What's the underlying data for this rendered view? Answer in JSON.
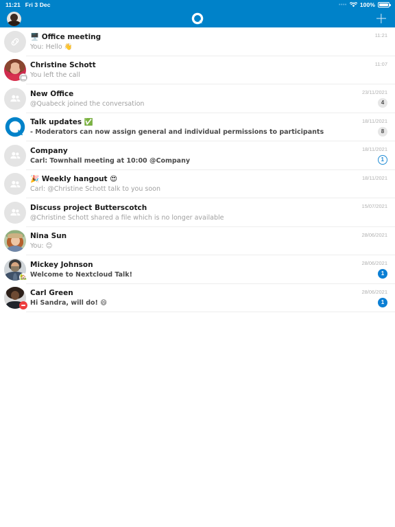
{
  "status_bar": {
    "time": "11:21",
    "date": "Fri 3 Dec",
    "signal_icon": "signal-dots-icon",
    "wifi_icon": "wifi-icon",
    "battery_percent": "100%",
    "battery_icon": "battery-full-icon"
  },
  "nav_bar": {
    "avatar_name": "user-avatar",
    "logo_icon": "nextcloud-talk-logo",
    "add_label": "+",
    "add_name": "new-conversation-button"
  },
  "colors": {
    "brand_blue": "#0082c9",
    "badge_blue": "#0b7fd4",
    "badge_outline_blue": "#1f8bd4",
    "divider": "#ededed",
    "title": "#1a1a1a",
    "subtitle": "#a0a0a0"
  },
  "conversations": [
    {
      "title": "🖥️ Office meeting",
      "subtitle": "You: Hello 👋",
      "subtitle_strong": false,
      "time": "11:21",
      "badge": "",
      "badge_style": "empty",
      "avatar_type": "link",
      "avatar_name": "avatar-link-conversation",
      "status": ""
    },
    {
      "title": "Christine Schott",
      "subtitle": "You left the call",
      "subtitle_strong": false,
      "time": "11:07",
      "badge": "",
      "badge_style": "empty",
      "avatar_type": "photo-christine",
      "avatar_name": "avatar-christine-schott",
      "status": "bubble"
    },
    {
      "title": "New Office",
      "subtitle": "@Quabeck joined the conversation",
      "subtitle_strong": false,
      "time": "23/11/2021",
      "badge": "4",
      "badge_style": "grey",
      "avatar_type": "group",
      "avatar_name": "avatar-group-new-office",
      "status": ""
    },
    {
      "title": "Talk updates ✅",
      "subtitle": "- Moderators can now assign general and individual permissions to participants",
      "subtitle_strong": true,
      "time": "18/11/2021",
      "badge": "8",
      "badge_style": "grey",
      "avatar_type": "talk-logo",
      "avatar_name": "avatar-talk-updates",
      "status": ""
    },
    {
      "title": "Company",
      "subtitle": "Carl: Townhall meeting at 10:00 @Company",
      "subtitle_strong": true,
      "time": "18/11/2021",
      "badge": "1",
      "badge_style": "outline",
      "avatar_type": "group",
      "avatar_name": "avatar-group-company",
      "status": ""
    },
    {
      "title": "🎉 Weekly hangout 😍",
      "subtitle": "Carl: @Christine Schott talk to you soon",
      "subtitle_strong": false,
      "time": "18/11/2021",
      "badge": "",
      "badge_style": "empty",
      "avatar_type": "group",
      "avatar_name": "avatar-group-weekly-hangout",
      "status": ""
    },
    {
      "title": "Discuss project Butterscotch",
      "subtitle": "@Christine Schott shared a file which is no longer available",
      "subtitle_strong": false,
      "time": "15/07/2021",
      "badge": "",
      "badge_style": "empty",
      "avatar_type": "group",
      "avatar_name": "avatar-group-discuss-project-butterscotch",
      "status": ""
    },
    {
      "title": "Nina Sun",
      "subtitle": "You: 😊",
      "subtitle_strong": false,
      "time": "28/06/2021",
      "badge": "",
      "badge_style": "empty",
      "avatar_type": "photo-nina",
      "avatar_name": "avatar-nina-sun",
      "status": ""
    },
    {
      "title": "Mickey Johnson",
      "subtitle": "Welcome to Nextcloud Talk!",
      "subtitle_strong": true,
      "time": "28/06/2021",
      "badge": "1",
      "badge_style": "filled",
      "avatar_type": "photo-mickey",
      "avatar_name": "avatar-mickey-johnson",
      "status": "home"
    },
    {
      "title": "Carl Green",
      "subtitle": "Hi Sandra, will do! 😄",
      "subtitle_strong": true,
      "time": "28/06/2021",
      "badge": "1",
      "badge_style": "filled",
      "avatar_type": "photo-carl",
      "avatar_name": "avatar-carl-green",
      "status": "dnd"
    }
  ]
}
